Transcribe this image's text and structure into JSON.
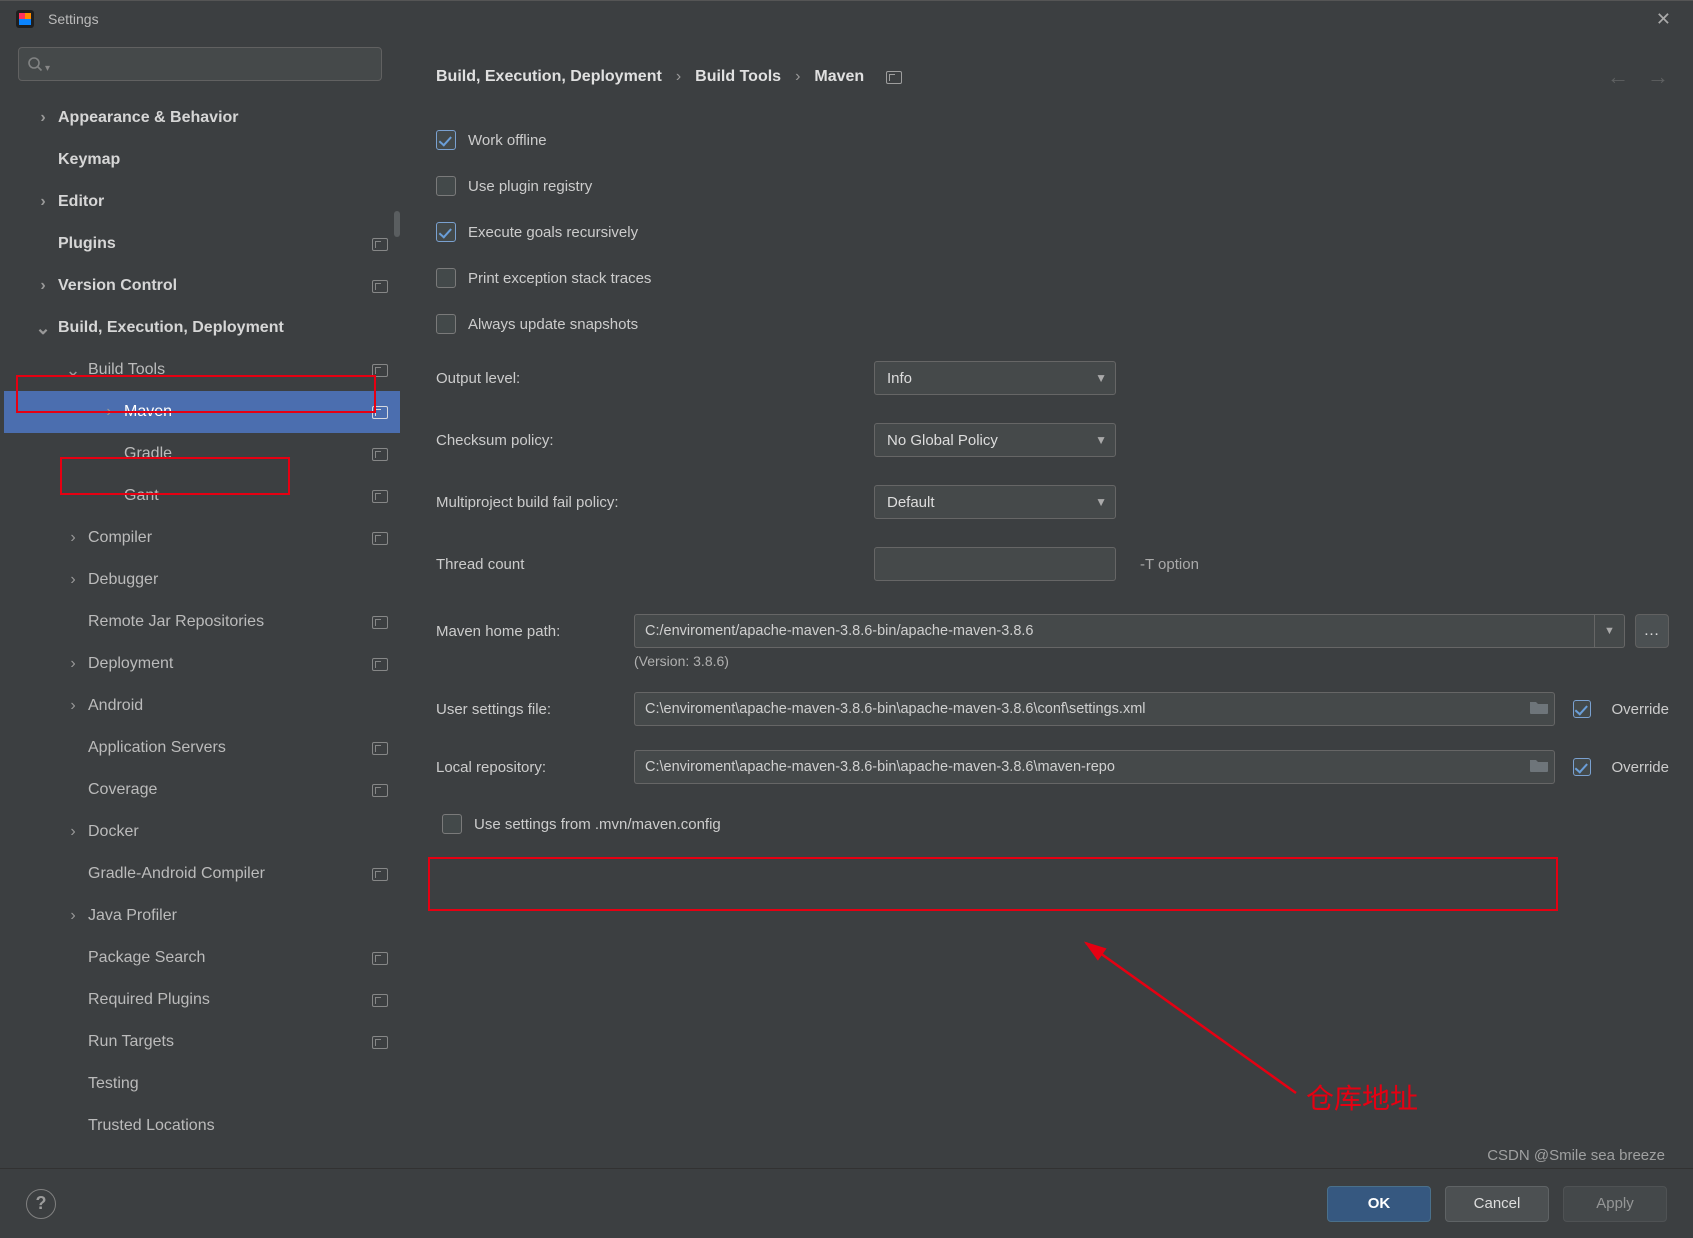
{
  "window": {
    "title": "Settings"
  },
  "sidebar": {
    "items": [
      {
        "label": "Appearance & Behavior",
        "arrow": ">",
        "bold": true,
        "level": 1
      },
      {
        "label": "Keymap",
        "arrow": "",
        "bold": true,
        "level": 1
      },
      {
        "label": "Editor",
        "arrow": ">",
        "bold": true,
        "level": 1
      },
      {
        "label": "Plugins",
        "arrow": "",
        "bold": true,
        "level": 1,
        "badge": true
      },
      {
        "label": "Version Control",
        "arrow": ">",
        "bold": true,
        "level": 1,
        "badge": true
      },
      {
        "label": "Build, Execution, Deployment",
        "arrow": "v",
        "bold": true,
        "level": 1
      },
      {
        "label": "Build Tools",
        "arrow": "v",
        "bold": false,
        "level": 2,
        "badge": true
      },
      {
        "label": "Maven",
        "arrow": ">",
        "bold": false,
        "level": 3,
        "badge": true,
        "selected": true
      },
      {
        "label": "Gradle",
        "arrow": "",
        "bold": false,
        "level": 3,
        "badge": true
      },
      {
        "label": "Gant",
        "arrow": "",
        "bold": false,
        "level": 3,
        "badge": true
      },
      {
        "label": "Compiler",
        "arrow": ">",
        "bold": false,
        "level": 2,
        "badge": true
      },
      {
        "label": "Debugger",
        "arrow": ">",
        "bold": false,
        "level": 2
      },
      {
        "label": "Remote Jar Repositories",
        "arrow": "",
        "bold": false,
        "level": 2,
        "badge": true
      },
      {
        "label": "Deployment",
        "arrow": ">",
        "bold": false,
        "level": 2,
        "badge": true
      },
      {
        "label": "Android",
        "arrow": ">",
        "bold": false,
        "level": 2
      },
      {
        "label": "Application Servers",
        "arrow": "",
        "bold": false,
        "level": 2,
        "badge": true
      },
      {
        "label": "Coverage",
        "arrow": "",
        "bold": false,
        "level": 2,
        "badge": true
      },
      {
        "label": "Docker",
        "arrow": ">",
        "bold": false,
        "level": 2
      },
      {
        "label": "Gradle-Android Compiler",
        "arrow": "",
        "bold": false,
        "level": 2,
        "badge": true
      },
      {
        "label": "Java Profiler",
        "arrow": ">",
        "bold": false,
        "level": 2
      },
      {
        "label": "Package Search",
        "arrow": "",
        "bold": false,
        "level": 2,
        "badge": true
      },
      {
        "label": "Required Plugins",
        "arrow": "",
        "bold": false,
        "level": 2,
        "badge": true
      },
      {
        "label": "Run Targets",
        "arrow": "",
        "bold": false,
        "level": 2,
        "badge": true
      },
      {
        "label": "Testing",
        "arrow": "",
        "bold": false,
        "level": 2
      },
      {
        "label": "Trusted Locations",
        "arrow": "",
        "bold": false,
        "level": 2
      }
    ]
  },
  "breadcrumbs": {
    "a": "Build, Execution, Deployment",
    "b": "Build Tools",
    "c": "Maven"
  },
  "checkboxes": {
    "work_offline": "Work offline",
    "use_plugin_registry": "Use plugin registry",
    "execute_recursive": "Execute goals recursively",
    "print_exceptions": "Print exception stack traces",
    "always_update": "Always update snapshots",
    "use_mvn_settings": "Use settings from .mvn/maven.config"
  },
  "fields": {
    "output_level": {
      "label": "Output level:",
      "value": "Info"
    },
    "checksum_policy": {
      "label": "Checksum policy:",
      "value": "No Global Policy"
    },
    "multiproject": {
      "label": "Multiproject build fail policy:",
      "value": "Default"
    },
    "thread_count": {
      "label": "Thread count",
      "value": "",
      "hint": "-T option"
    },
    "maven_home": {
      "label": "Maven home path:",
      "value": "C:/enviroment/apache-maven-3.8.6-bin/apache-maven-3.8.6"
    },
    "version_note": "(Version: 3.8.6)",
    "user_settings": {
      "label": "User settings file:",
      "value": "C:\\enviroment\\apache-maven-3.8.6-bin\\apache-maven-3.8.6\\conf\\settings.xml",
      "override": "Override"
    },
    "local_repo": {
      "label": "Local repository:",
      "value": "C:\\enviroment\\apache-maven-3.8.6-bin\\apache-maven-3.8.6\\maven-repo",
      "override": "Override"
    }
  },
  "annotation": {
    "text": "仓库地址"
  },
  "footer": {
    "ok": "OK",
    "cancel": "Cancel",
    "apply": "Apply"
  },
  "watermark": "CSDN @Smile sea breeze",
  "glyphs": {
    "sep": "›",
    "caret": "▼",
    "arrow_right": "›",
    "arrow_down": "⌄",
    "back": "←",
    "fwd": "→"
  }
}
